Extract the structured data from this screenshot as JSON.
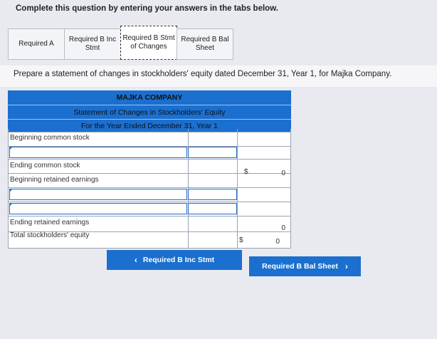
{
  "instruction": "Complete this question by entering your answers in the tabs below.",
  "tabs": [
    {
      "label": "Required A",
      "active": false
    },
    {
      "label": "Required B Inc Stmt",
      "active": false
    },
    {
      "label": "Required B Stmt of Changes",
      "active": true
    },
    {
      "label": "Required B Bal Sheet",
      "active": false
    }
  ],
  "prompt": "Prepare a statement of changes in stockholders' equity dated December 31, Year 1, for Majka Company.",
  "statement": {
    "company": "MAJKA COMPANY",
    "title": "Statement of Changes in Stockholders' Equity",
    "period": "For the Year Ended December 31, Year 1",
    "rows": {
      "beginning_common": "Beginning common stock",
      "ending_common": "Ending common stock",
      "beginning_retained": "Beginning retained earnings",
      "ending_retained": "Ending retained earnings",
      "total_equity": "Total stockholders' equity"
    },
    "currency": "$",
    "values": {
      "ending_common": "0",
      "ending_retained": "0",
      "total_equity": "0"
    }
  },
  "nav": {
    "prev_label": "Required B Inc Stmt",
    "next_label": "Required B Bal Sheet",
    "prev_chevron": "‹",
    "next_chevron": "›"
  },
  "colors": {
    "accent": "#1b6fcf",
    "input_border": "#2468c8"
  }
}
